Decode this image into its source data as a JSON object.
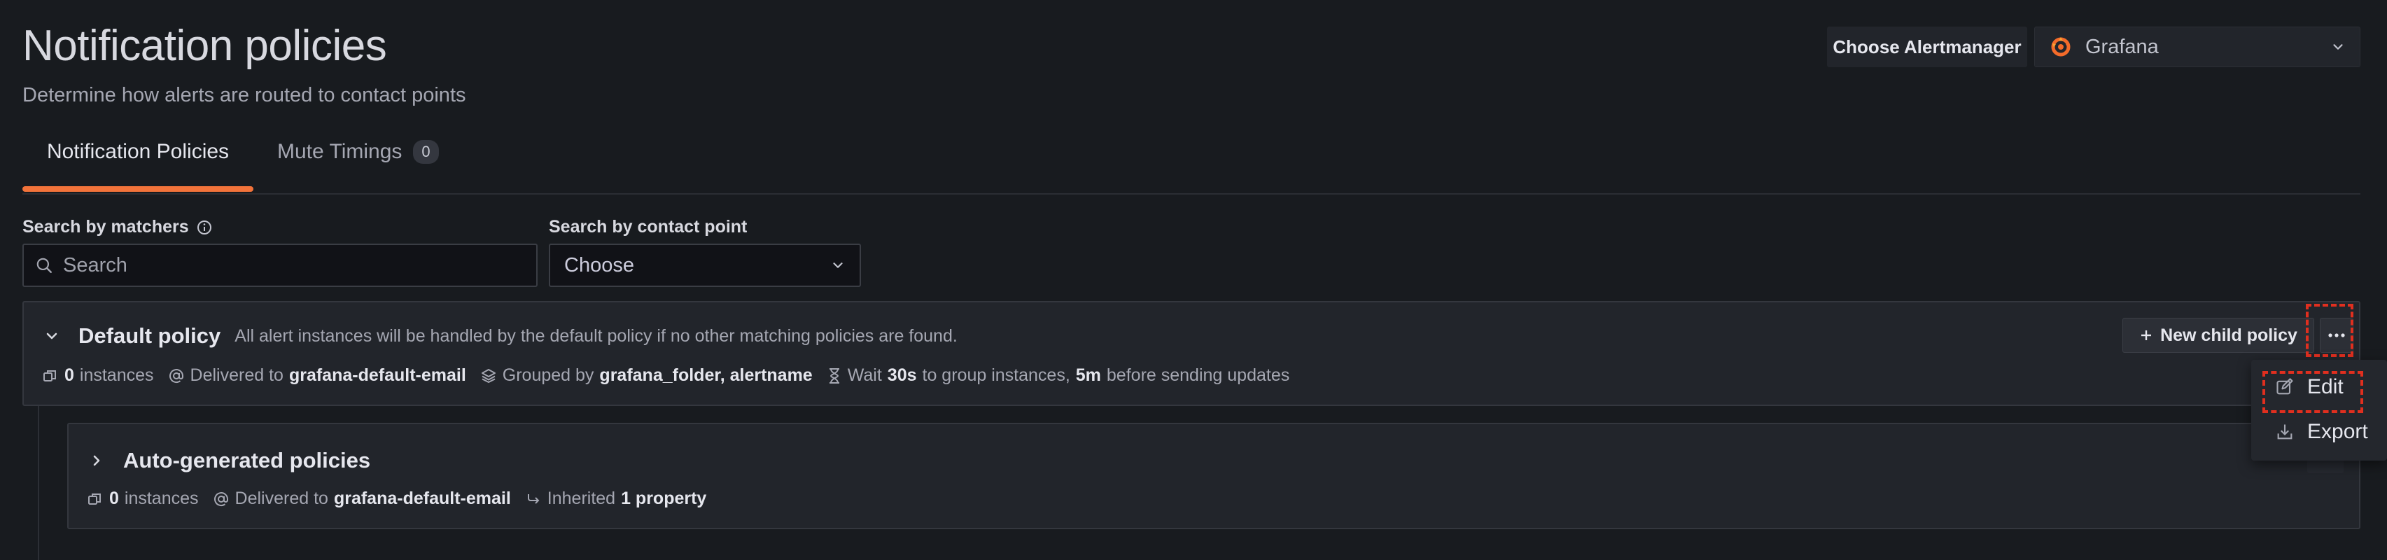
{
  "header": {
    "title": "Notification policies",
    "subtitle": "Determine how alerts are routed to contact points"
  },
  "alertmanager": {
    "label": "Choose Alertmanager",
    "selected": "Grafana",
    "icon": "grafana-logo-icon"
  },
  "tabs": [
    {
      "label": "Notification Policies",
      "active": true
    },
    {
      "label": "Mute Timings",
      "count": "0",
      "active": false
    }
  ],
  "filters": {
    "matchers_label": "Search by matchers",
    "matchers_placeholder": "Search",
    "contact_point_label": "Search by contact point",
    "contact_point_value": "Choose"
  },
  "default_policy": {
    "name": "Default policy",
    "description": "All alert instances will be handled by the default policy if no other matching policies are found.",
    "instances_count": "0",
    "instances_label": "instances",
    "delivered_prefix": "Delivered to",
    "contact_point": "grafana-default-email",
    "grouped_prefix": "Grouped by",
    "group_by": "grafana_folder, alertname",
    "wait_prefix": "Wait",
    "group_wait": "30s",
    "group_wait_suffix": "to group instances,",
    "group_interval": "5m",
    "group_interval_suffix": "before sending updates",
    "new_child_label": "New child policy",
    "more_label": "..."
  },
  "child_policy": {
    "name": "Auto-generated policies",
    "instances_count": "0",
    "instances_label": "instances",
    "delivered_prefix": "Delivered to",
    "contact_point": "grafana-default-email",
    "inherited_prefix": "Inherited",
    "inherited_value": "1 property"
  },
  "menu": {
    "edit_label": "Edit",
    "export_label": "Export"
  },
  "colors": {
    "accent": "#f2733a",
    "highlight": "#e02f1f",
    "background": "#181b1f"
  }
}
